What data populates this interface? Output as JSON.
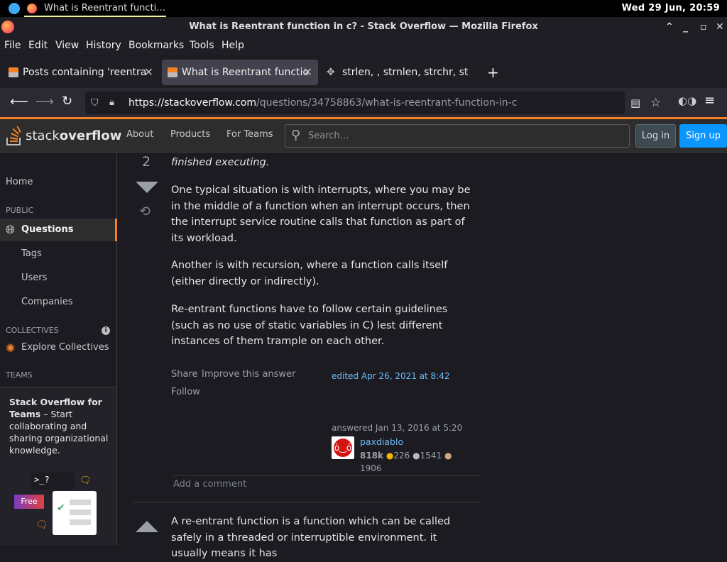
{
  "system": {
    "task_title": "What is Reentrant functi…",
    "clock": "Wed 29 Jun, 20:59"
  },
  "window": {
    "title": "What is Reentrant function in c? - Stack Overflow — Mozilla Firefox"
  },
  "menu": [
    "File",
    "Edit",
    "View",
    "History",
    "Bookmarks",
    "Tools",
    "Help"
  ],
  "tabs": [
    {
      "label": "Posts containing 'reentra"
    },
    {
      "label": "What is Reentrant functio"
    },
    {
      "label": "strlen, , strnlen, strchr, st"
    }
  ],
  "url": {
    "host": "https://stackoverflow.com",
    "path": "/questions/34758863/what-is-reentrant-function-in-c"
  },
  "so_header": {
    "logo_a": "stack",
    "logo_b": "overflow",
    "about": "About",
    "products": "Products",
    "for_teams": "For Teams",
    "search_placeholder": "Search…",
    "login": "Log in",
    "signup": "Sign up"
  },
  "sidebar": {
    "home": "Home",
    "public": "PUBLIC",
    "questions": "Questions",
    "tags": "Tags",
    "users": "Users",
    "companies": "Companies",
    "collectives": "COLLECTIVES",
    "explore_collectives": "Explore Collectives",
    "teams": "TEAMS",
    "teams_title": "Stack Overflow for Teams",
    "teams_desc": " – Start collaborating and sharing organizational knowledge.",
    "free_badge": "Free",
    "prompt": ">_?"
  },
  "answer": {
    "score": "2",
    "p0": "finished executing.",
    "p1": "One typical situation is with interrupts, where you may be in the middle of a function when an interrupt occurs, then the interrupt service routine calls that function as part of its workload.",
    "p2": "Another is with recursion, where a function calls itself (either directly or indirectly).",
    "p3": "Re-entrant functions have to follow certain guidelines (such as no use of static variables in C) lest different instances of them trample on each other.",
    "share": "Share",
    "improve": "Improve this answer",
    "follow": "Follow",
    "edited": "edited Apr 26, 2021 at 8:42",
    "answered": "answered Jan 13, 2016 at 5:20",
    "user": "paxdiablo",
    "rep": "818k",
    "gold": "226",
    "silver": "1541",
    "bronze": "1906",
    "add_comment": "Add a comment"
  },
  "next_answer": {
    "text": "A re-entrant function is a function which can be called safely in a threaded or interruptible environment. it usually means it has"
  },
  "colors": {
    "accent": "#f48225",
    "link": "#6cbbf7",
    "signup": "#0a95ff",
    "gold": "#f1b600",
    "silver": "#b4b8bc",
    "bronze": "#d1a684"
  }
}
